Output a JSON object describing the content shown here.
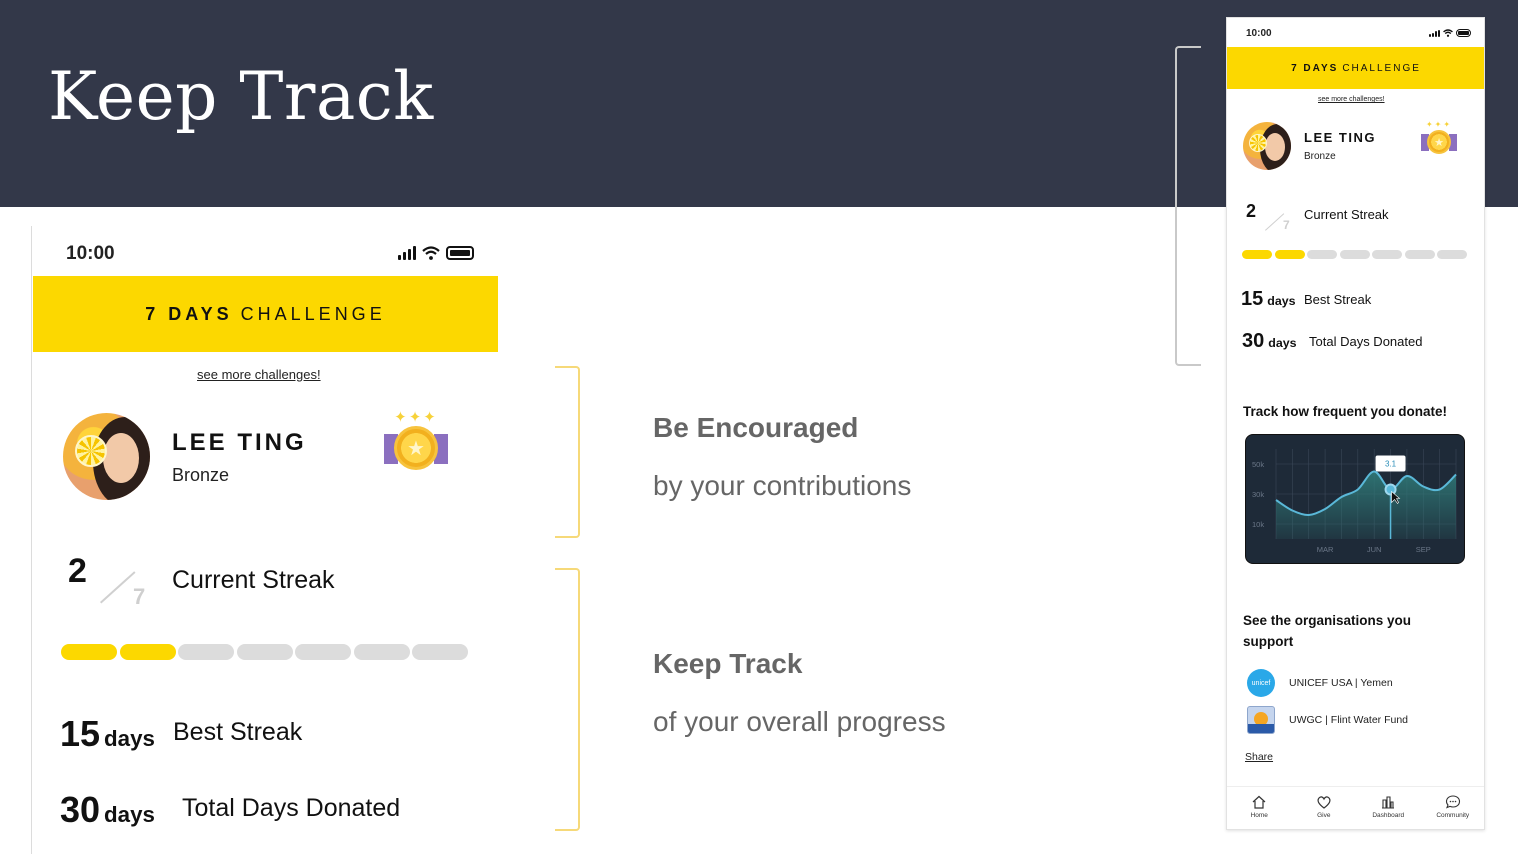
{
  "slide": {
    "title": "Keep Track"
  },
  "phone": {
    "time": "10:00",
    "challenge_bold": "7 DAYS",
    "challenge_rest": "CHALLENGE",
    "see_more": "see more challenges!",
    "user": {
      "name": "LEE TING",
      "rank": "Bronze"
    },
    "streak": {
      "current": "2",
      "total": "7",
      "label": "Current Streak",
      "progress": [
        1,
        1,
        0,
        0,
        0,
        0,
        0
      ]
    },
    "best": {
      "value": "15",
      "unit": "days",
      "label": "Best Streak"
    },
    "donated": {
      "value": "30",
      "unit": "days",
      "label": "Total Days Donated"
    }
  },
  "features": [
    {
      "title": "Be Encouraged",
      "subtitle": "by your contributions"
    },
    {
      "title": "Keep Track",
      "subtitle": "of your overall progress"
    }
  ],
  "mini": {
    "chart_title": "Track how frequent you donate!",
    "org_title": "See the organisations you support",
    "orgs": [
      {
        "name": "UNICEF USA | Yemen",
        "icon": "unicef-logo-icon",
        "logo_text": "unicef"
      },
      {
        "name": "UWGC | Flint Water Fund",
        "icon": "uwgc-logo-icon"
      }
    ],
    "share": "Share",
    "nav": [
      {
        "label": "Home",
        "icon": "home-icon"
      },
      {
        "label": "Give",
        "icon": "heart-icon"
      },
      {
        "label": "Dashboard",
        "icon": "dashboard-icon"
      },
      {
        "label": "Community",
        "icon": "chat-icon"
      }
    ]
  },
  "chart_data": {
    "type": "line",
    "x": [
      0,
      1,
      2,
      3,
      4,
      5,
      6,
      7,
      8,
      9,
      10,
      11
    ],
    "series": [
      {
        "values": [
          26,
          19,
          16,
          20,
          28,
          33,
          45,
          33,
          42,
          35,
          33,
          43
        ]
      }
    ],
    "ylim": [
      0,
      60
    ],
    "y_ticks": [
      "10k",
      "30k",
      "50k"
    ],
    "x_ticks": [
      "MAR",
      "JUN",
      "SEP"
    ],
    "x_tick_positions": [
      3,
      6,
      9
    ],
    "tooltip": {
      "label": "3.1",
      "x": 7
    },
    "grid": true,
    "colors": {
      "background": "#1e2a38",
      "line": "#5ab8d8",
      "fill": "#2f7a78",
      "grid": "#3a4758",
      "tooltip_text": "#2a8db8"
    }
  },
  "colors": {
    "brand_yellow": "#fcd800",
    "band": "#333849",
    "pill_off": "#dcdcdc"
  }
}
